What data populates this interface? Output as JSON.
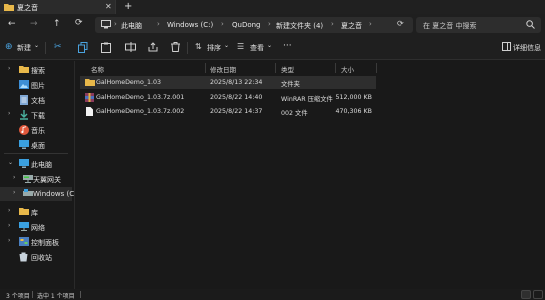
{
  "tab": {
    "title": "夏之音",
    "close_icon": "close-icon",
    "new_tab_icon": "plus-icon"
  },
  "nav": {
    "breadcrumbs": [
      "此电脑",
      "Windows (C:)",
      "QuDong",
      "新建文件夹 (4)",
      "夏之音"
    ],
    "search_placeholder": "在 夏之音 中搜索"
  },
  "toolbar": {
    "new_label": "新建",
    "sort_label": "排序",
    "view_label": "查看",
    "more_label": "···",
    "details_label": "详细信息"
  },
  "sidebar": {
    "items": [
      {
        "label": "搜索",
        "icon": "folder-icon"
      },
      {
        "label": "图片",
        "icon": "pictures-icon"
      },
      {
        "label": "文档",
        "icon": "documents-icon"
      },
      {
        "label": "下载",
        "icon": "downloads-icon"
      },
      {
        "label": "音乐",
        "icon": "music-icon"
      },
      {
        "label": "桌面",
        "icon": "desktop-icon"
      },
      {
        "label": "此电脑",
        "icon": "computer-icon"
      },
      {
        "label": "天翼网关",
        "icon": "network-drive-icon"
      },
      {
        "label": "Windows (C",
        "icon": "drive-icon"
      },
      {
        "label": "库",
        "icon": "library-icon"
      },
      {
        "label": "网络",
        "icon": "network-icon"
      },
      {
        "label": "控制面板",
        "icon": "control-panel-icon"
      },
      {
        "label": "回收站",
        "icon": "recycle-bin-icon"
      }
    ]
  },
  "columns": {
    "name": "名称",
    "modified": "修改日期",
    "type": "类型",
    "size": "大小"
  },
  "files": [
    {
      "name": "GalHomeDemo_1.03",
      "modified": "2025/8/13 22:34",
      "type": "文件夹",
      "size": "",
      "icon": "folder-icon"
    },
    {
      "name": "GalHomeDemo_1.03.7z.001",
      "modified": "2025/8/22 14:40",
      "type": "WinRAR 压缩文件",
      "size": "512,000 KB",
      "icon": "winrar-archive-icon"
    },
    {
      "name": "GalHomeDemo_1.03.7z.002",
      "modified": "2025/8/22 14:37",
      "type": "002 文件",
      "size": "470,306 KB",
      "icon": "file-icon"
    }
  ],
  "status": {
    "count": "3 个项目",
    "selected": "选中 1 个项目"
  },
  "colors": {
    "background": "#191919",
    "folder": "#e8b84a",
    "accent": "#4aa3df",
    "selected_row": "#2e2e2e"
  }
}
